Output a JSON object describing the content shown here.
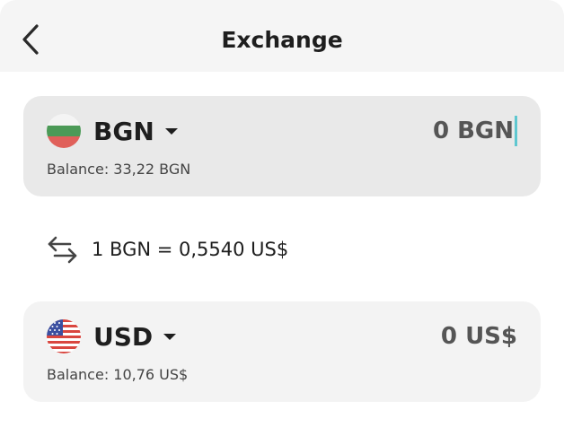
{
  "header": {
    "title": "Exchange",
    "back_icon": "chevron-left-icon"
  },
  "from": {
    "flag_icon": "flag-bulgaria-icon",
    "currency": "BGN",
    "amount": "0 BGN",
    "balance": "Balance: 33,22 BGN",
    "background": "#e9e9e9"
  },
  "rate": {
    "icon": "swap-arrows-icon",
    "text": "1 BGN = 0,5540 US$"
  },
  "to": {
    "flag_icon": "flag-usa-icon",
    "currency": "USD",
    "amount": "0 US$",
    "balance": "Balance: 10,76 US$",
    "background": "#f3f3f3"
  },
  "colors": {
    "cursor": "#5fc7d0",
    "header_bg": "#f5f5f5"
  }
}
